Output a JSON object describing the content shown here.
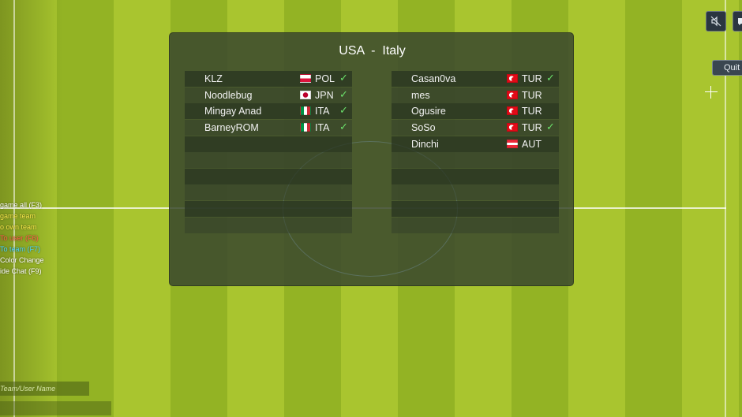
{
  "match": {
    "title": "USA  -  Italy"
  },
  "left_team": {
    "players": [
      {
        "name": "KLZ",
        "country": "POL",
        "ready": true
      },
      {
        "name": "Noodlebug",
        "country": "JPN",
        "ready": true
      },
      {
        "name": "Mingay Anad",
        "country": "ITA",
        "ready": true
      },
      {
        "name": "BarneyROM",
        "country": "ITA",
        "ready": true
      }
    ]
  },
  "right_team": {
    "players": [
      {
        "name": "Casan0va",
        "country": "TUR",
        "ready": true
      },
      {
        "name": "mes",
        "country": "TUR",
        "ready": false
      },
      {
        "name": "Ogusire",
        "country": "TUR",
        "ready": false
      },
      {
        "name": "SoSo",
        "country": "TUR",
        "ready": true
      },
      {
        "name": "Dinchi",
        "country": "AUT",
        "ready": false
      }
    ]
  },
  "check_mark": "✓",
  "left_menu": {
    "items": [
      {
        "label": "game all (F3)",
        "color": "#ffffff"
      },
      {
        "label": "game team",
        "color": "#f5e64a"
      },
      {
        "label": "o own team",
        "color": "#f5e64a"
      },
      {
        "label": "To user (F6)",
        "color": "#ff5a4a"
      },
      {
        "label": "To team (F7)",
        "color": "#4ad7ff"
      },
      {
        "label": "Color Change",
        "color": "#ffffff"
      },
      {
        "label": "ide Chat (F9)",
        "color": "#ffffff"
      }
    ]
  },
  "team_user_input": {
    "placeholder": "Team/User Name"
  },
  "top_controls": {
    "quit_label": "Quit",
    "mute_icon": "speaker-muted-icon",
    "chat_icon": "chat-bubble-icon"
  }
}
